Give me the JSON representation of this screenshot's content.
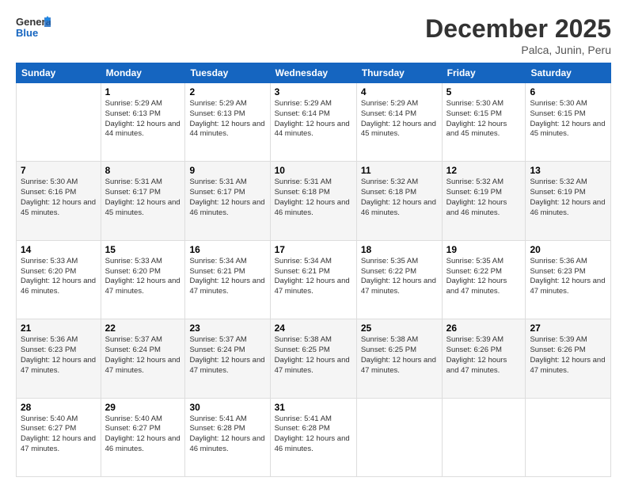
{
  "header": {
    "logo_general": "General",
    "logo_blue": "Blue",
    "title": "December 2025",
    "subtitle": "Palca, Junin, Peru"
  },
  "weekdays": [
    "Sunday",
    "Monday",
    "Tuesday",
    "Wednesday",
    "Thursday",
    "Friday",
    "Saturday"
  ],
  "weeks": [
    [
      {
        "day": "",
        "sunrise": "",
        "sunset": "",
        "daylight": ""
      },
      {
        "day": "1",
        "sunrise": "Sunrise: 5:29 AM",
        "sunset": "Sunset: 6:13 PM",
        "daylight": "Daylight: 12 hours and 44 minutes."
      },
      {
        "day": "2",
        "sunrise": "Sunrise: 5:29 AM",
        "sunset": "Sunset: 6:13 PM",
        "daylight": "Daylight: 12 hours and 44 minutes."
      },
      {
        "day": "3",
        "sunrise": "Sunrise: 5:29 AM",
        "sunset": "Sunset: 6:14 PM",
        "daylight": "Daylight: 12 hours and 44 minutes."
      },
      {
        "day": "4",
        "sunrise": "Sunrise: 5:29 AM",
        "sunset": "Sunset: 6:14 PM",
        "daylight": "Daylight: 12 hours and 45 minutes."
      },
      {
        "day": "5",
        "sunrise": "Sunrise: 5:30 AM",
        "sunset": "Sunset: 6:15 PM",
        "daylight": "Daylight: 12 hours and 45 minutes."
      },
      {
        "day": "6",
        "sunrise": "Sunrise: 5:30 AM",
        "sunset": "Sunset: 6:15 PM",
        "daylight": "Daylight: 12 hours and 45 minutes."
      }
    ],
    [
      {
        "day": "7",
        "sunrise": "Sunrise: 5:30 AM",
        "sunset": "Sunset: 6:16 PM",
        "daylight": "Daylight: 12 hours and 45 minutes."
      },
      {
        "day": "8",
        "sunrise": "Sunrise: 5:31 AM",
        "sunset": "Sunset: 6:17 PM",
        "daylight": "Daylight: 12 hours and 45 minutes."
      },
      {
        "day": "9",
        "sunrise": "Sunrise: 5:31 AM",
        "sunset": "Sunset: 6:17 PM",
        "daylight": "Daylight: 12 hours and 46 minutes."
      },
      {
        "day": "10",
        "sunrise": "Sunrise: 5:31 AM",
        "sunset": "Sunset: 6:18 PM",
        "daylight": "Daylight: 12 hours and 46 minutes."
      },
      {
        "day": "11",
        "sunrise": "Sunrise: 5:32 AM",
        "sunset": "Sunset: 6:18 PM",
        "daylight": "Daylight: 12 hours and 46 minutes."
      },
      {
        "day": "12",
        "sunrise": "Sunrise: 5:32 AM",
        "sunset": "Sunset: 6:19 PM",
        "daylight": "Daylight: 12 hours and 46 minutes."
      },
      {
        "day": "13",
        "sunrise": "Sunrise: 5:32 AM",
        "sunset": "Sunset: 6:19 PM",
        "daylight": "Daylight: 12 hours and 46 minutes."
      }
    ],
    [
      {
        "day": "14",
        "sunrise": "Sunrise: 5:33 AM",
        "sunset": "Sunset: 6:20 PM",
        "daylight": "Daylight: 12 hours and 46 minutes."
      },
      {
        "day": "15",
        "sunrise": "Sunrise: 5:33 AM",
        "sunset": "Sunset: 6:20 PM",
        "daylight": "Daylight: 12 hours and 47 minutes."
      },
      {
        "day": "16",
        "sunrise": "Sunrise: 5:34 AM",
        "sunset": "Sunset: 6:21 PM",
        "daylight": "Daylight: 12 hours and 47 minutes."
      },
      {
        "day": "17",
        "sunrise": "Sunrise: 5:34 AM",
        "sunset": "Sunset: 6:21 PM",
        "daylight": "Daylight: 12 hours and 47 minutes."
      },
      {
        "day": "18",
        "sunrise": "Sunrise: 5:35 AM",
        "sunset": "Sunset: 6:22 PM",
        "daylight": "Daylight: 12 hours and 47 minutes."
      },
      {
        "day": "19",
        "sunrise": "Sunrise: 5:35 AM",
        "sunset": "Sunset: 6:22 PM",
        "daylight": "Daylight: 12 hours and 47 minutes."
      },
      {
        "day": "20",
        "sunrise": "Sunrise: 5:36 AM",
        "sunset": "Sunset: 6:23 PM",
        "daylight": "Daylight: 12 hours and 47 minutes."
      }
    ],
    [
      {
        "day": "21",
        "sunrise": "Sunrise: 5:36 AM",
        "sunset": "Sunset: 6:23 PM",
        "daylight": "Daylight: 12 hours and 47 minutes."
      },
      {
        "day": "22",
        "sunrise": "Sunrise: 5:37 AM",
        "sunset": "Sunset: 6:24 PM",
        "daylight": "Daylight: 12 hours and 47 minutes."
      },
      {
        "day": "23",
        "sunrise": "Sunrise: 5:37 AM",
        "sunset": "Sunset: 6:24 PM",
        "daylight": "Daylight: 12 hours and 47 minutes."
      },
      {
        "day": "24",
        "sunrise": "Sunrise: 5:38 AM",
        "sunset": "Sunset: 6:25 PM",
        "daylight": "Daylight: 12 hours and 47 minutes."
      },
      {
        "day": "25",
        "sunrise": "Sunrise: 5:38 AM",
        "sunset": "Sunset: 6:25 PM",
        "daylight": "Daylight: 12 hours and 47 minutes."
      },
      {
        "day": "26",
        "sunrise": "Sunrise: 5:39 AM",
        "sunset": "Sunset: 6:26 PM",
        "daylight": "Daylight: 12 hours and 47 minutes."
      },
      {
        "day": "27",
        "sunrise": "Sunrise: 5:39 AM",
        "sunset": "Sunset: 6:26 PM",
        "daylight": "Daylight: 12 hours and 47 minutes."
      }
    ],
    [
      {
        "day": "28",
        "sunrise": "Sunrise: 5:40 AM",
        "sunset": "Sunset: 6:27 PM",
        "daylight": "Daylight: 12 hours and 47 minutes."
      },
      {
        "day": "29",
        "sunrise": "Sunrise: 5:40 AM",
        "sunset": "Sunset: 6:27 PM",
        "daylight": "Daylight: 12 hours and 46 minutes."
      },
      {
        "day": "30",
        "sunrise": "Sunrise: 5:41 AM",
        "sunset": "Sunset: 6:28 PM",
        "daylight": "Daylight: 12 hours and 46 minutes."
      },
      {
        "day": "31",
        "sunrise": "Sunrise: 5:41 AM",
        "sunset": "Sunset: 6:28 PM",
        "daylight": "Daylight: 12 hours and 46 minutes."
      },
      {
        "day": "",
        "sunrise": "",
        "sunset": "",
        "daylight": ""
      },
      {
        "day": "",
        "sunrise": "",
        "sunset": "",
        "daylight": ""
      },
      {
        "day": "",
        "sunrise": "",
        "sunset": "",
        "daylight": ""
      }
    ]
  ]
}
